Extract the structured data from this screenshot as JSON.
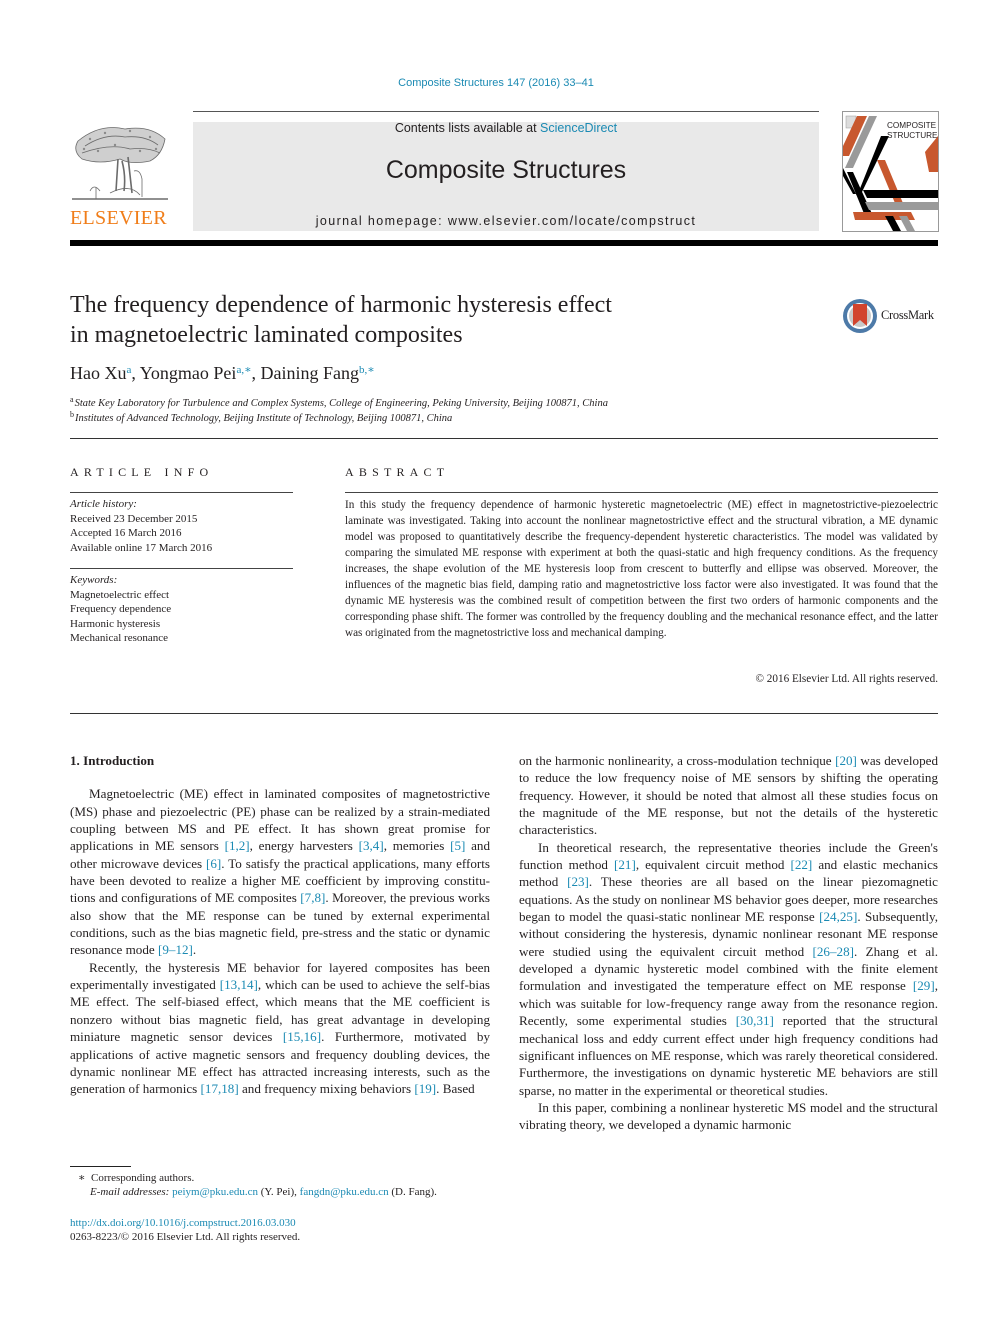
{
  "citation": "Composite Structures 147 (2016) 33–41",
  "header": {
    "publisher_logo_text": "ELSEVIER",
    "contents_prefix": "Contents lists available at ",
    "contents_link": "ScienceDirect",
    "journal_name": "Composite Structures",
    "homepage_prefix": "journal homepage: ",
    "homepage_url": "www.elsevier.com/locate/compstruct",
    "cover_title_line1": "COMPOSITE",
    "cover_title_line2": "STRUCTURES",
    "colors": {
      "elsevier_orange": "#f07d19",
      "link_blue": "#1b8ab3",
      "cover_orange": "#c8582e",
      "cover_gray": "#9a9a9a"
    }
  },
  "article": {
    "title_line1": "The frequency dependence of harmonic hysteresis effect",
    "title_line2": "in magnetoelectric laminated composites",
    "crossmark_label": "CrossMark",
    "authors": [
      {
        "name": "Hao Xu",
        "sup": "a",
        "sep": ", "
      },
      {
        "name": "Yongmao Pei",
        "sup": "a,∗",
        "sep": ", "
      },
      {
        "name": "Daining Fang",
        "sup": "b,∗",
        "sep": ""
      }
    ],
    "affiliations": [
      {
        "mark": "a",
        "text": "State Key Laboratory for Turbulence and Complex Systems, College of Engineering, Peking University, Beijing 100871, China"
      },
      {
        "mark": "b",
        "text": "Institutes of Advanced Technology, Beijing Institute of Technology, Beijing 100871, China"
      }
    ]
  },
  "article_info": {
    "heading": "ARTICLE INFO",
    "history_label": "Article history:",
    "history": [
      "Received 23 December 2015",
      "Accepted 16 March 2016",
      "Available online 17 March 2016"
    ],
    "keywords_label": "Keywords:",
    "keywords": [
      "Magnetoelectric effect",
      "Frequency dependence",
      "Harmonic hysteresis",
      "Mechanical resonance"
    ]
  },
  "abstract": {
    "heading": "ABSTRACT",
    "text": "In this study the frequency dependence of harmonic hysteretic magnetoelectric (ME) effect in magnetostrictive-piezoelectric laminate was investigated. Taking into account the nonlinear magne­tostrictive effect and the structural vibration, a ME dynamic model was proposed to quantitatively describe the frequency-dependent hysteretic characteristics. The model was validated by comparing the simulated ME response with experiment at both the quasi-static and high frequency conditions. As the frequency increases, the shape evolution of the ME hysteresis loop from crescent to butterfly and ellipse was observed. Moreover, the influences of the magnetic bias field, damping ratio and magne­tostrictive loss factor were also investigated. It was found that the dynamic ME hysteresis was the com­bined result of competition between the first two orders of harmonic components and the corresponding phase shift. The former was controlled by the frequency doubling and the mechanical resonance effect, and the latter was originated from the magnetostrictive loss and mechanical damping.",
    "copyright": "© 2016 Elsevier Ltd. All rights reserved."
  },
  "body": {
    "section_heading": "1. Introduction",
    "left_paragraphs": [
      [
        {
          "t": "Magnetoelectric (ME) effect in laminated composites of magne­tostrictive (MS) phase and piezoelectric (PE) phase can be realized by a strain-mediated coupling between MS and PE effect. It has shown great promise for applications in ME sensors "
        },
        {
          "ref": "[1,2]"
        },
        {
          "t": ", energy harvesters "
        },
        {
          "ref": "[3,4]"
        },
        {
          "t": ", memories "
        },
        {
          "ref": "[5]"
        },
        {
          "t": " and other microwave devices "
        },
        {
          "ref": "[6]"
        },
        {
          "t": ". To satisfy the practical applications, many efforts have been devoted to realize a higher ME coefficient by improving constitu­tions and configurations of ME composites "
        },
        {
          "ref": "[7,8]"
        },
        {
          "t": ". Moreover, the previous works also show that the ME response can be tuned by external experimental conditions, such as the bias magnetic field, pre-stress and the static or dynamic resonance mode "
        },
        {
          "ref": "[9–12]"
        },
        {
          "t": "."
        }
      ],
      [
        {
          "t": "Recently, the hysteresis ME behavior for layered composites has been experimentally investigated "
        },
        {
          "ref": "[13,14]"
        },
        {
          "t": ", which can be used to achieve the self-bias ME effect. The self-biased effect, which means that the ME coefficient is nonzero without bias magnetic field, has great advantage in developing miniature magnetic sensor devices "
        },
        {
          "ref": "[15,16]"
        },
        {
          "t": ". Furthermore, motivated by applications of active magnetic sensors and frequency doubling devices, the dynamic nonlinear ME effect has attracted increasing interests, such as the generation of harmonics "
        },
        {
          "ref": "[17,18]"
        },
        {
          "t": " and frequency mixing behaviors "
        },
        {
          "ref": "[19]"
        },
        {
          "t": ". Based"
        }
      ]
    ],
    "right_paragraphs": [
      [
        {
          "t": "on the harmonic nonlinearity, a cross-modulation technique "
        },
        {
          "ref": "[20]"
        },
        {
          "t": " was developed to reduce the low frequency noise of ME sensors by shifting the operating frequency. However, it should be noted that almost all these studies focus on the magnitude of the ME response, but not the details of the hysteretic characteristics."
        }
      ],
      [
        {
          "t": "In theoretical research, the representative theories include the Green's function method "
        },
        {
          "ref": "[21]"
        },
        {
          "t": ", equivalent circuit method "
        },
        {
          "ref": "[22]"
        },
        {
          "t": " and elastic mechanics method "
        },
        {
          "ref": "[23]"
        },
        {
          "t": ". These theories are all based on the linear piezomagnetic equations. As the study on nonlinear MS behavior goes deeper, more researches began to model the quasi-static nonlinear ME response "
        },
        {
          "ref": "[24,25]"
        },
        {
          "t": ". Subsequently, without considering the hysteresis, dynamic nonlinear resonant ME response were studied using the equivalent circuit method "
        },
        {
          "ref": "[26–28]"
        },
        {
          "t": ". Zhang et al. developed a dynamic hysteretic model combined with the finite element formulation and investigated the tempera­ture effect on ME response "
        },
        {
          "ref": "[29]"
        },
        {
          "t": ", which was suitable for low-frequency range away from the resonance region. Recently, some experimental studies "
        },
        {
          "ref": "[30,31]"
        },
        {
          "t": " reported that the structural mechan­ical loss and eddy current effect under high frequency conditions had significant influences on ME response, which was rarely theo­retical considered. Furthermore, the investigations on dynamic hysteretic ME behaviors are still sparse, no matter in the experi­mental or theoretical studies."
        }
      ],
      [
        {
          "t": "In this paper, combining a nonlinear hysteretic MS model and the structural vibrating theory, we developed a dynamic harmonic"
        }
      ]
    ]
  },
  "footnotes": {
    "corresponding_mark": "∗",
    "corresponding_text": "Corresponding authors.",
    "email_label": "E-mail addresses: ",
    "emails": [
      {
        "address": "peiym@pku.edu.cn",
        "who": " (Y. Pei), "
      },
      {
        "address": "fangdn@pku.edu.cn",
        "who": " (D. Fang)."
      }
    ],
    "doi": "http://dx.doi.org/10.1016/j.compstruct.2016.03.030",
    "issn_line": "0263-8223/© 2016 Elsevier Ltd. All rights reserved."
  }
}
